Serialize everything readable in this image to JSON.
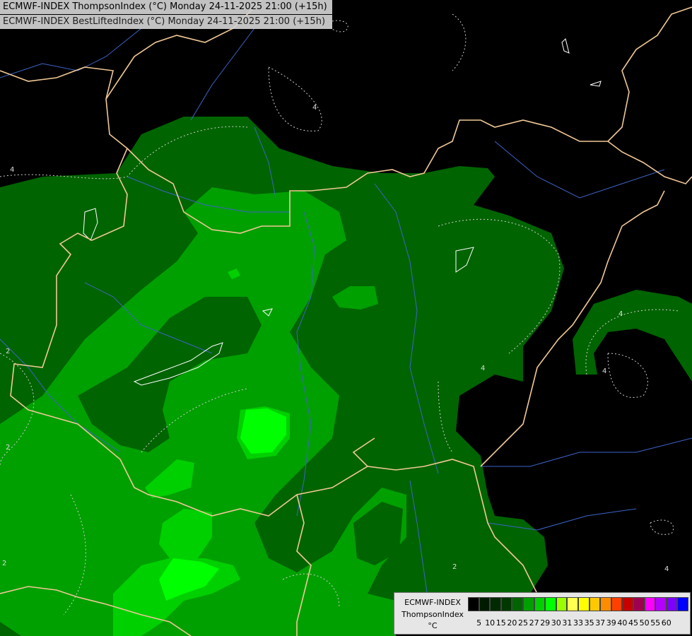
{
  "titles": {
    "line1": "ECMWF-INDEX ThompsonIndex (°C) Monday 24-11-2025 21:00 (+15h)",
    "line2": "ECMWF-INDEX BestLiftedIndex (°C) Monday 24-11-2025 21:00 (+15h)"
  },
  "legend": {
    "source": "ECMWF-INDEX",
    "parameter": "ThompsonIndex",
    "unit": "°C",
    "ticks": [
      "5",
      "10",
      "15",
      "20",
      "25",
      "27",
      "29",
      "30",
      "31",
      "33",
      "35",
      "37",
      "39",
      "40",
      "45",
      "50",
      "55",
      "60"
    ],
    "colors": [
      "#000000",
      "#001a00",
      "#002a00",
      "#003800",
      "#006400",
      "#00a000",
      "#00d000",
      "#00ff00",
      "#9aff00",
      "#ffff50",
      "#ffff00",
      "#ffc800",
      "#ff8c00",
      "#ff4000",
      "#c80000",
      "#a00050",
      "#ff00ff",
      "#b400ff",
      "#7d00ff",
      "#0000ff"
    ]
  },
  "contour_labels": [
    "4",
    "4",
    "4",
    "4",
    "4",
    "2",
    "2",
    "2",
    "2",
    "4"
  ],
  "colors": {
    "background": "#000000",
    "border": "#f0c896",
    "river": "#3c64c8",
    "lake": "#ffffff",
    "contour": "#cfcfcf"
  }
}
